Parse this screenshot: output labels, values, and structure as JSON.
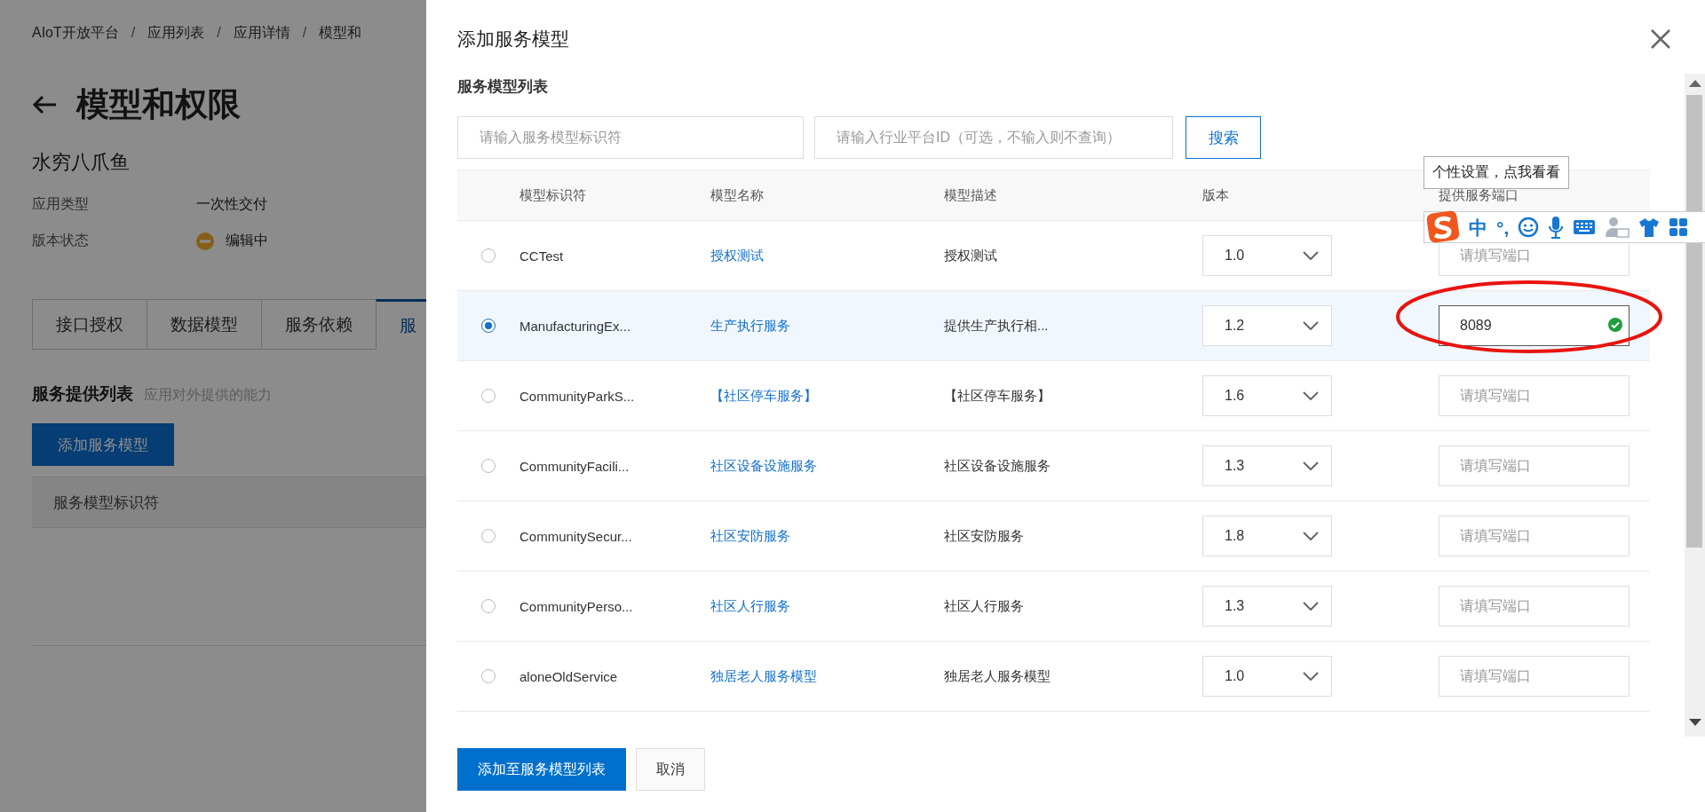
{
  "page": {
    "breadcrumb": [
      "AIoT开放平台",
      "应用列表",
      "应用详情",
      "模型和"
    ],
    "separator": "/",
    "title": "模型和权限",
    "app_name": "水穷八爪鱼",
    "info": [
      {
        "label": "应用类型",
        "value": "一次性交付",
        "kind": "text"
      },
      {
        "label": "版本状态",
        "value": "编辑中",
        "kind": "status"
      }
    ],
    "tabs": [
      {
        "label": "接口授权",
        "selected": false
      },
      {
        "label": "数据模型",
        "selected": false
      },
      {
        "label": "服务依赖",
        "selected": false
      },
      {
        "label": "服",
        "selected": true
      }
    ],
    "section": {
      "title": "服务提供列表",
      "hint": "应用对外提供的能力"
    },
    "add_button": "添加服务模型",
    "table_columns": [
      "服务模型标识符"
    ]
  },
  "drawer": {
    "title": "添加服务模型",
    "section_title": "服务模型列表",
    "search_fields": [
      {
        "placeholder": "请输入服务模型标识符"
      },
      {
        "placeholder": "请输入行业平台ID（可选，不输入则不查询）"
      }
    ],
    "search_button": "搜索",
    "columns": [
      "模型标识符",
      "模型名称",
      "模型描述",
      "版本",
      "提供服务端口"
    ],
    "rows": [
      {
        "selected": false,
        "id": "CCTest",
        "name": "授权测试",
        "description": "授权测试",
        "version": "1.0",
        "port": {
          "placeholder": "请填写端口",
          "valid": false
        }
      },
      {
        "selected": true,
        "id": "ManufacturingEx...",
        "name": "生产执行服务",
        "description": "提供生产执行相...",
        "version": "1.2",
        "port": {
          "value": "8089",
          "valid": true
        }
      },
      {
        "selected": false,
        "id": "CommunityParkS...",
        "name": "【社区停车服务】",
        "description": "【社区停车服务】",
        "version": "1.6",
        "port": {
          "placeholder": "请填写端口",
          "valid": false
        }
      },
      {
        "selected": false,
        "id": "CommunityFacili...",
        "name": "社区设备设施服务",
        "description": "社区设备设施服务",
        "version": "1.3",
        "port": {
          "placeholder": "请填写端口",
          "valid": false
        }
      },
      {
        "selected": false,
        "id": "CommunitySecur...",
        "name": "社区安防服务",
        "description": "社区安防服务",
        "version": "1.8",
        "port": {
          "placeholder": "请填写端口",
          "valid": false
        }
      },
      {
        "selected": false,
        "id": "CommunityPerso...",
        "name": "社区人行服务",
        "description": "社区人行服务",
        "version": "1.3",
        "port": {
          "placeholder": "请填写端口",
          "valid": false
        }
      },
      {
        "selected": false,
        "id": "aloneOldService",
        "name": "独居老人服务模型",
        "description": "独居老人服务模型",
        "version": "1.0",
        "port": {
          "placeholder": "请填写端口",
          "valid": false
        }
      }
    ],
    "footer_buttons": [
      {
        "label": "添加至服务模型列表",
        "kind": "primary"
      },
      {
        "label": "取消",
        "kind": "default"
      }
    ],
    "tooltip": "个性设置，点我看看",
    "ime": {
      "mode": "中",
      "punctuation": "°,"
    }
  }
}
